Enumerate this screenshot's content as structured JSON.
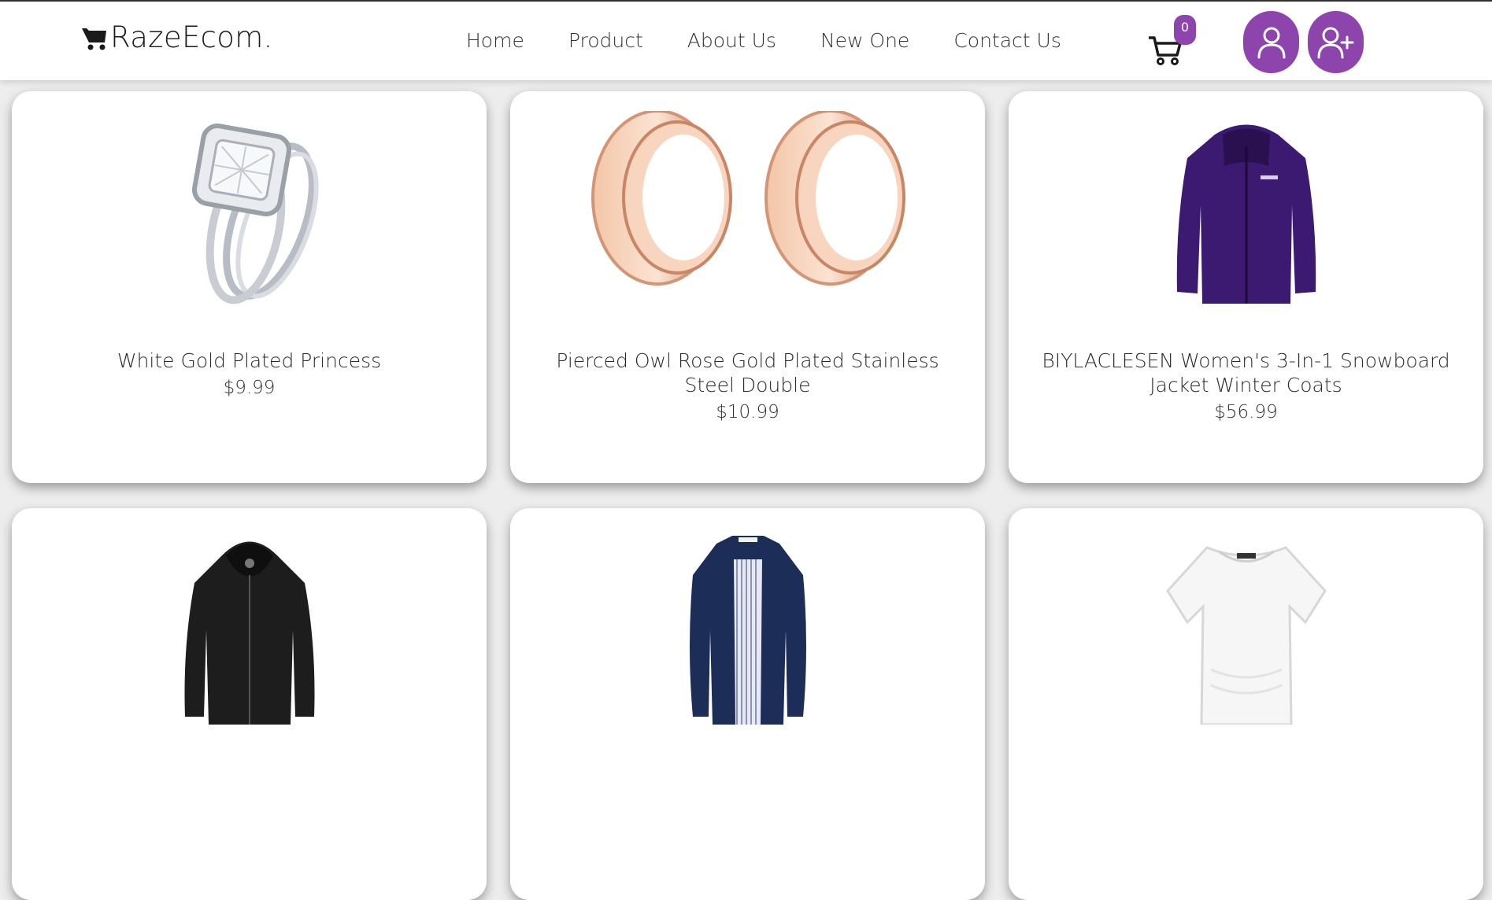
{
  "brand": {
    "name": "RazeEcom."
  },
  "nav": {
    "links": [
      "Home",
      "Product",
      "About Us",
      "New One",
      "Contact Us"
    ]
  },
  "cart": {
    "count": "0"
  },
  "colors": {
    "accent": "#8e44ad"
  },
  "icons": {
    "brand": "cart-icon",
    "cart": "shopping-cart-icon",
    "user": "user-icon",
    "register": "user-plus-icon"
  },
  "products": [
    {
      "title": "White Gold Plated Princess",
      "price": "$9.99",
      "image": "ring"
    },
    {
      "title": "Pierced Owl Rose Gold Plated Stainless Steel Double",
      "price": "$10.99",
      "image": "plugs"
    },
    {
      "title": "BIYLACLESEN Women's 3-In-1 Snowboard Jacket Winter Coats",
      "price": "$56.99",
      "image": "purple-jacket"
    },
    {
      "title": "",
      "price": "",
      "image": "black-jacket"
    },
    {
      "title": "",
      "price": "",
      "image": "navy-coat"
    },
    {
      "title": "",
      "price": "",
      "image": "white-tshirt"
    }
  ]
}
